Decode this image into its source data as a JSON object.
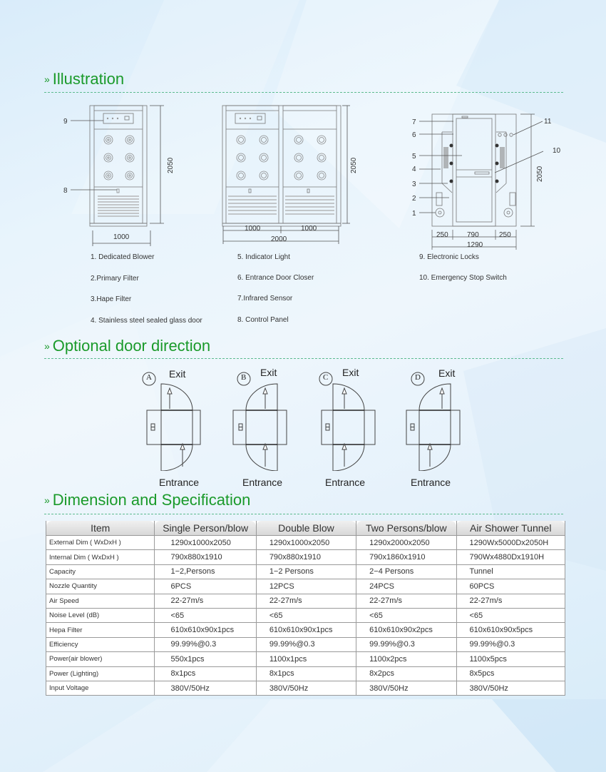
{
  "sections": {
    "illustration": "Illustration",
    "door_direction": "Optional door direction",
    "dimension": "Dimension and Specification"
  },
  "section_marker": "»",
  "colors": {
    "title_green": "#1a9a2a",
    "dash_line": "#5dbb8f",
    "drawing_stroke": "#666666"
  },
  "illustration": {
    "single": {
      "callouts": [
        "9",
        "8"
      ],
      "height_dim": "2050",
      "width_dim": "1000"
    },
    "double": {
      "height_dim": "2050",
      "width_left": "1000",
      "width_right": "1000",
      "width_total": "2000"
    },
    "side": {
      "callouts_left": [
        "7",
        "6",
        "5",
        "4",
        "3",
        "2",
        "1"
      ],
      "callouts_right": [
        "11",
        "10"
      ],
      "height_dim": "2050",
      "width_segments": [
        "250",
        "790",
        "250"
      ],
      "width_total": "1290"
    },
    "legend": [
      "1. Dedicated Blower",
      "2.Primary Filter",
      "3.Hape Filter",
      "4. Stainless steel sealed glass door",
      "5. Indicator Light",
      "6. Entrance Door Closer",
      "7.Infrared Sensor",
      "8. Control Panel",
      "9. Electronic  Locks",
      "10. Emergency Stop Switch"
    ]
  },
  "door_options": [
    {
      "letter": "A",
      "exit": "Exit",
      "entrance": "Entrance"
    },
    {
      "letter": "B",
      "exit": "Exit",
      "entrance": "Entrance"
    },
    {
      "letter": "C",
      "exit": "Exit",
      "entrance": "Entrance"
    },
    {
      "letter": "D",
      "exit": "Exit",
      "entrance": "Entrance"
    }
  ],
  "spec_table": {
    "headers": [
      "Item",
      "Single Person/blow",
      "Double Blow",
      "Two Persons/blow",
      "Air Shower Tunnel"
    ],
    "rows": [
      [
        "External Dim ( WxDxH )",
        "1290x1000x2050",
        "1290x1000x2050",
        "1290x2000x2050",
        "1290Wx5000Dx2050H"
      ],
      [
        "Internal Dim  ( WxDxH )",
        "790x880x1910",
        "790x880x1910",
        "790x1860x1910",
        "790Wx4880Dx1910H"
      ],
      [
        "Capacity",
        "1−2,Persons",
        "1−2 Persons",
        "2−4 Persons",
        "Tunnel"
      ],
      [
        "Nozzle Quantity",
        "6PCS",
        "12PCS",
        "24PCS",
        "60PCS"
      ],
      [
        "Air Speed",
        "22-27m/s",
        "22-27m/s",
        "22-27m/s",
        "22-27m/s"
      ],
      [
        "Noise Level (dB)",
        "<65",
        "<65",
        "<65",
        "<65"
      ],
      [
        "Hepa Filter",
        "610x610x90x1pcs",
        "610x610x90x1pcs",
        "610x610x90x2pcs",
        "610x610x90x5pcs"
      ],
      [
        "Efficiency",
        "99.99%@0.3",
        "99.99%@0.3",
        "99.99%@0.3",
        "99.99%@0.3"
      ],
      [
        "Power(air blower)",
        "550x1pcs",
        "1100x1pcs",
        "1100x2pcs",
        "1100x5pcs"
      ],
      [
        "Power (Lighting)",
        "8x1pcs",
        "8x1pcs",
        "8x2pcs",
        "8x5pcs"
      ],
      [
        "Input Voltage",
        "380V/50Hz",
        "380V/50Hz",
        "380V/50Hz",
        "380V/50Hz"
      ]
    ]
  }
}
